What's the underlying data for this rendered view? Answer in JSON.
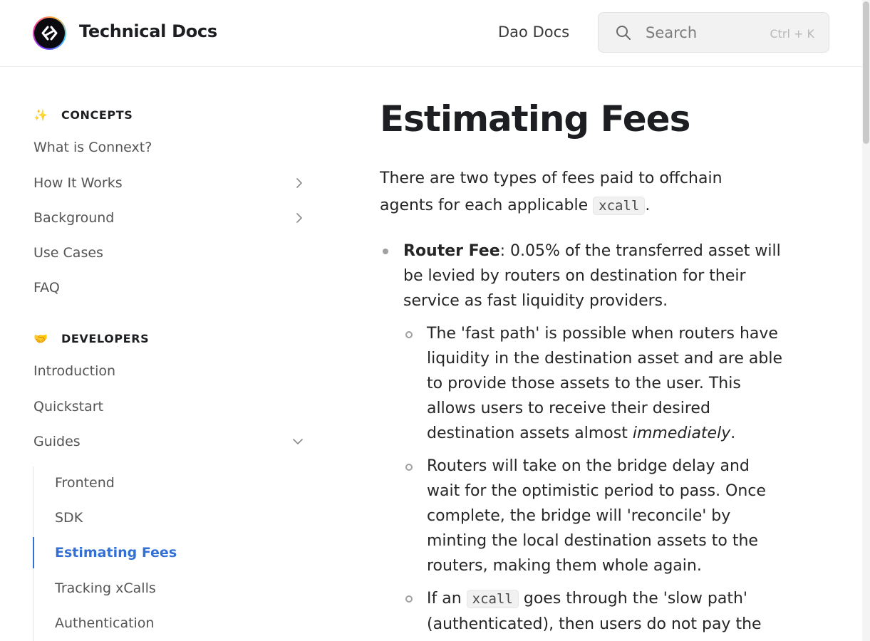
{
  "header": {
    "brand": "Technical Docs",
    "nav_link": "Dao Docs",
    "search": {
      "placeholder": "Search",
      "shortcut": "Ctrl + K"
    }
  },
  "sidebar": {
    "concepts": {
      "title": "CONCEPTS",
      "emoji": "✨",
      "items": [
        {
          "label": "What is Connext?"
        },
        {
          "label": "How It Works"
        },
        {
          "label": "Background"
        },
        {
          "label": "Use Cases"
        },
        {
          "label": "FAQ"
        }
      ]
    },
    "developers": {
      "title": "DEVELOPERS",
      "emoji": "🤝",
      "items": [
        {
          "label": "Introduction"
        },
        {
          "label": "Quickstart"
        },
        {
          "label": "Guides"
        }
      ],
      "guides_children": [
        {
          "label": "Frontend"
        },
        {
          "label": "SDK"
        },
        {
          "label": "Estimating Fees"
        },
        {
          "label": "Tracking xCalls"
        },
        {
          "label": "Authentication"
        }
      ]
    }
  },
  "main": {
    "title": "Estimating Fees",
    "intro_before": "There are two types of fees paid to offchain agents for each applicable ",
    "intro_code": "xcall",
    "intro_after": ".",
    "router_fee_label": "Router Fee",
    "router_fee_text": ": 0.05% of the transferred asset will be levied by routers on destination for their service as fast liquidity providers.",
    "sub1_before": "The 'fast path' is possible when routers have liquidity in the destination asset and are able to provide those assets to the user. This allows users to receive their desired destination assets almost ",
    "sub1_em": "immediately",
    "sub1_after": ".",
    "sub2": "Routers will take on the bridge delay and wait for the optimistic period to pass. Once complete, the bridge will 'reconcile' by minting the local destination assets to the routers, making them whole again.",
    "sub3_before": "If an ",
    "sub3_code": "xcall",
    "sub3_after": " goes through the 'slow path' (authenticated), then users do not pay the"
  }
}
